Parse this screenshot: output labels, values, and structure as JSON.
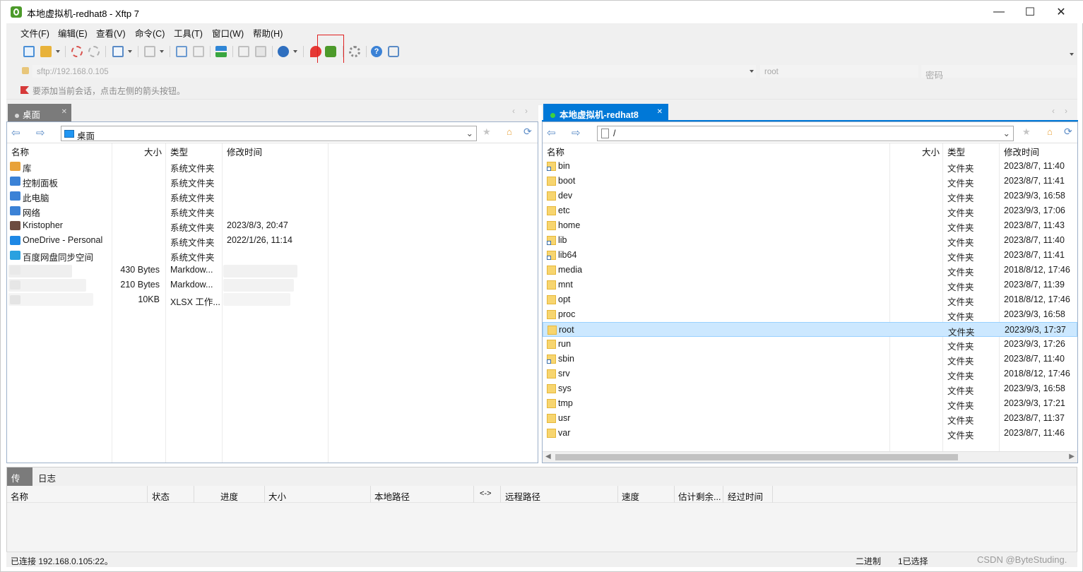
{
  "window": {
    "title": "本地虚拟机-redhat8 - Xftp 7"
  },
  "menu": [
    "文件(F)",
    "编辑(E)",
    "查看(V)",
    "命令(C)",
    "工具(T)",
    "窗口(W)",
    "帮助(H)"
  ],
  "address": {
    "url_placeholder": "sftp://192.168.0.105",
    "user_placeholder": "root",
    "password_placeholder": "密码"
  },
  "infobar": {
    "text": "要添加当前会话，点击左侧的箭头按钮。"
  },
  "left": {
    "tab_label": "桌面",
    "path": "桌面",
    "headers": {
      "name": "名称",
      "size": "大小",
      "type": "类型",
      "modified": "修改时间"
    },
    "rows": [
      {
        "icon": "library-icon",
        "name": "库",
        "size": "",
        "type": "系统文件夹",
        "modified": ""
      },
      {
        "icon": "control-panel-icon",
        "name": "控制面板",
        "size": "",
        "type": "系统文件夹",
        "modified": ""
      },
      {
        "icon": "computer-icon",
        "name": "此电脑",
        "size": "",
        "type": "系统文件夹",
        "modified": ""
      },
      {
        "icon": "network-icon",
        "name": "网络",
        "size": "",
        "type": "系统文件夹",
        "modified": ""
      },
      {
        "icon": "user-icon",
        "name": "Kristopher",
        "size": "",
        "type": "系统文件夹",
        "modified": "2023/8/3, 20:47"
      },
      {
        "icon": "onedrive-icon",
        "name": "OneDrive - Personal",
        "size": "",
        "type": "系统文件夹",
        "modified": "2022/1/26, 11:14"
      },
      {
        "icon": "baidu-icon",
        "name": "百度网盘同步空间",
        "size": "",
        "type": "系统文件夹",
        "modified": ""
      },
      {
        "icon": "file-icon",
        "name": "",
        "size": "430 Bytes",
        "type": "Markdow...",
        "modified": ""
      },
      {
        "icon": "file-icon",
        "name": "",
        "size": "210 Bytes",
        "type": "Markdow...",
        "modified": ""
      },
      {
        "icon": "file-icon",
        "name": "",
        "size": "10KB",
        "type": "XLSX 工作...",
        "modified": ""
      }
    ]
  },
  "right": {
    "tab_label": "本地虚拟机-redhat8",
    "path": "/",
    "headers": {
      "name": "名称",
      "size": "大小",
      "type": "类型",
      "modified": "修改时间"
    },
    "rows": [
      {
        "name": "bin",
        "link": true,
        "type": "文件夹",
        "modified": "2023/8/7, 11:40"
      },
      {
        "name": "boot",
        "link": false,
        "type": "文件夹",
        "modified": "2023/8/7, 11:41"
      },
      {
        "name": "dev",
        "link": false,
        "type": "文件夹",
        "modified": "2023/9/3, 16:58"
      },
      {
        "name": "etc",
        "link": false,
        "type": "文件夹",
        "modified": "2023/9/3, 17:06"
      },
      {
        "name": "home",
        "link": false,
        "type": "文件夹",
        "modified": "2023/8/7, 11:43"
      },
      {
        "name": "lib",
        "link": true,
        "type": "文件夹",
        "modified": "2023/8/7, 11:40"
      },
      {
        "name": "lib64",
        "link": true,
        "type": "文件夹",
        "modified": "2023/8/7, 11:41"
      },
      {
        "name": "media",
        "link": false,
        "type": "文件夹",
        "modified": "2018/8/12, 17:46"
      },
      {
        "name": "mnt",
        "link": false,
        "type": "文件夹",
        "modified": "2023/8/7, 11:39"
      },
      {
        "name": "opt",
        "link": false,
        "type": "文件夹",
        "modified": "2018/8/12, 17:46"
      },
      {
        "name": "proc",
        "link": false,
        "type": "文件夹",
        "modified": "2023/9/3, 16:58"
      },
      {
        "name": "root",
        "link": false,
        "type": "文件夹",
        "modified": "2023/9/3, 17:37",
        "selected": true
      },
      {
        "name": "run",
        "link": false,
        "type": "文件夹",
        "modified": "2023/9/3, 17:26"
      },
      {
        "name": "sbin",
        "link": true,
        "type": "文件夹",
        "modified": "2023/8/7, 11:40"
      },
      {
        "name": "srv",
        "link": false,
        "type": "文件夹",
        "modified": "2018/8/12, 17:46"
      },
      {
        "name": "sys",
        "link": false,
        "type": "文件夹",
        "modified": "2023/9/3, 16:58"
      },
      {
        "name": "tmp",
        "link": false,
        "type": "文件夹",
        "modified": "2023/9/3, 17:21"
      },
      {
        "name": "usr",
        "link": false,
        "type": "文件夹",
        "modified": "2023/8/7, 11:37"
      },
      {
        "name": "var",
        "link": false,
        "type": "文件夹",
        "modified": "2023/8/7, 11:46"
      }
    ]
  },
  "bottom": {
    "tabs": [
      "传输",
      "日志"
    ],
    "columns": [
      "名称",
      "状态",
      "进度",
      "大小",
      "本地路径",
      "<->",
      "远程路径",
      "速度",
      "估计剩余...",
      "经过时间"
    ]
  },
  "status": {
    "connection": "已连接 192.168.0.105:22。",
    "mode": "二进制",
    "selection": "1已选择",
    "watermark": "CSDN @ByteStuding."
  },
  "colors": {
    "accent": "#0078d7",
    "selected_row": "#cce8ff",
    "highlight_box": "#e02020",
    "folder": "#f7d56f"
  }
}
